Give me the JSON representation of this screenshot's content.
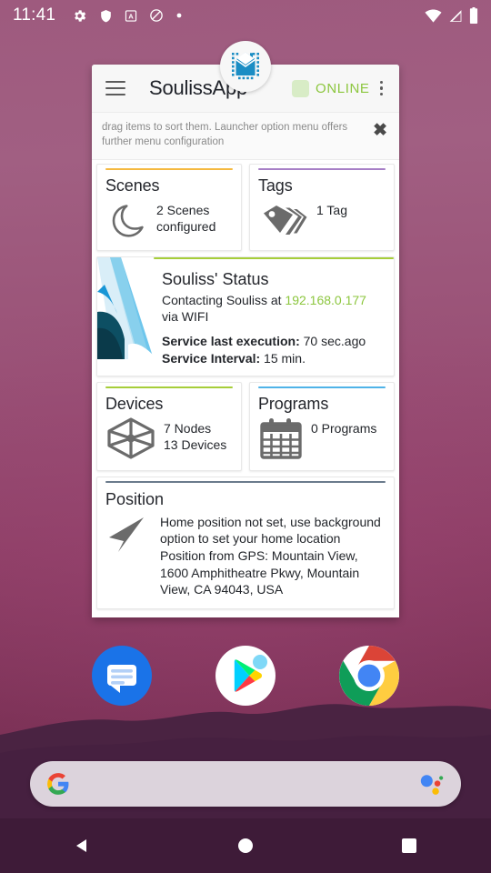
{
  "statusbar": {
    "clock": "11:41",
    "left_icons": [
      {
        "name": "settings-gear-icon"
      },
      {
        "name": "shield-icon"
      },
      {
        "name": "adguard-a-icon"
      },
      {
        "name": "do-not-disturb-icon"
      },
      {
        "name": "dot-icon"
      }
    ],
    "right_icons": [
      {
        "name": "wifi-icon"
      },
      {
        "name": "cellular-signal-icon"
      },
      {
        "name": "battery-icon"
      }
    ]
  },
  "widget": {
    "app_logo_icon": "souliss-house-mail-icon",
    "menu_icon": "hamburger-menu-icon",
    "title": "SoulissApp",
    "connection_status": "ONLINE",
    "status_color": "#8cc63e",
    "overflow_icon": "overflow-menu-icon",
    "hint": {
      "text": "drag items to sort them. Launcher option menu offers further menu configuration",
      "close_icon": "close-icon"
    },
    "tiles": {
      "scenes": {
        "title": "Scenes",
        "accent": "#f5b940",
        "icon": "moon-icon",
        "lines": [
          "2 Scenes",
          "configured"
        ]
      },
      "tags": {
        "title": "Tags",
        "accent": "#a77fc6",
        "icon": "tags-icon",
        "lines": [
          "1 Tag"
        ]
      },
      "status": {
        "title": "Souliss' Status",
        "accent": "#a6ce39",
        "thumb_icon": "souliss-banner-image",
        "contacting_prefix": "Contacting Souliss at ",
        "ip": "192.168.0.177",
        "contacting_suffix": " via WIFI",
        "last_execution_label": "Service last execution:",
        "last_execution_value": " 70 sec.ago",
        "interval_label": "Service Interval:",
        "interval_value": " 15 min."
      },
      "devices": {
        "title": "Devices",
        "accent": "#a6ce39",
        "icon": "cube-nodes-icon",
        "lines": [
          "7 Nodes",
          "13 Devices"
        ]
      },
      "programs": {
        "title": "Programs",
        "accent": "#4fb3e8",
        "icon": "calendar-icon",
        "lines": [
          "0 Programs"
        ]
      },
      "position": {
        "title": "Position",
        "accent": "#6b7b8c",
        "icon": "navigation-arrow-icon",
        "text": "Home position not set, use background option to set your home location Position from GPS: Mountain View, 1600 Amphitheatre Pkwy, Mountain View, CA 94043, USA"
      }
    }
  },
  "dock": {
    "apps": [
      {
        "name": "messages-app-icon",
        "label": "Messages"
      },
      {
        "name": "play-store-app-icon",
        "label": "Play Store"
      },
      {
        "name": "chrome-app-icon",
        "label": "Chrome"
      }
    ]
  },
  "search": {
    "google_icon": "google-g-icon",
    "assistant_icon": "google-assistant-icon",
    "placeholder": ""
  },
  "navbar": {
    "back_icon": "back-triangle-icon",
    "home_icon": "home-circle-icon",
    "recents_icon": "recents-square-icon"
  }
}
